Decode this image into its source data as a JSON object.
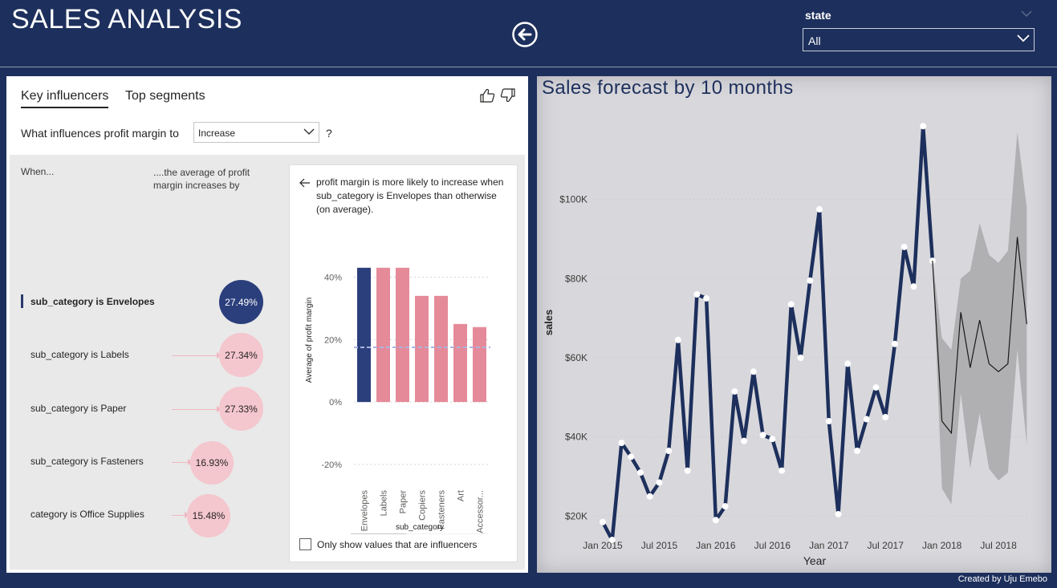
{
  "header": {
    "title": "SALES ANALYSIS",
    "back_icon": "back-arrow-circle-icon",
    "state_filter": {
      "label": "state",
      "value": "All"
    }
  },
  "key_influencers": {
    "tabs": [
      "Key influencers",
      "Top segments"
    ],
    "question_prefix": "What influences profit margin to",
    "question_value": "Increase",
    "question_suffix": "?",
    "when_header": "When...",
    "avg_header": "....the average of profit margin increases by",
    "influencers": [
      {
        "label": "sub_category is Envelopes",
        "value": "27.49%",
        "selected": true
      },
      {
        "label": "sub_category is Labels",
        "value": "27.34%",
        "selected": false
      },
      {
        "label": "sub_category is Paper",
        "value": "27.33%",
        "selected": false
      },
      {
        "label": "sub_category is Fasteners",
        "value": "16.93%",
        "selected": false
      },
      {
        "label": "category is Office Supplies",
        "value": "15.48%",
        "selected": false
      }
    ],
    "detail": {
      "text": "profit margin is more likely to increase when sub_category is Envelopes than otherwise (on average).",
      "checkbox_label": "Only show values that are influencers"
    },
    "colors": {
      "selected": "#2b3f7c",
      "other": "#f4c6cd",
      "bar_selected": "#2b3f7c",
      "bar_other": "#e58a99"
    }
  },
  "chart_data": [
    {
      "type": "bar",
      "categories": [
        "Envelopes",
        "Labels",
        "Paper",
        "Copiers",
        "Fasteners",
        "Art",
        "Accessor..."
      ],
      "values": [
        43,
        43,
        43,
        34,
        34,
        25,
        24
      ],
      "ylabel": "Average of profit margin",
      "xlabel": "sub_category",
      "yticks": [
        "40%",
        "20%",
        "0%",
        "-20%"
      ],
      "ylim": [
        -20,
        45
      ],
      "reference_line": 17.5
    },
    {
      "type": "line",
      "title": "Sales forecast by 10 months",
      "xlabel": "Year",
      "ylabel": "sales",
      "xticks": [
        "Jan 2015",
        "Jul 2015",
        "Jan 2016",
        "Jul 2016",
        "Jan 2017",
        "Jul 2017",
        "Jan 2018",
        "Jul 2018"
      ],
      "yticks": [
        "$100K",
        "$80K",
        "$60K",
        "$40K",
        "$20K"
      ],
      "ylim": [
        13000,
        122000
      ],
      "series": [
        {
          "values": [
            18500,
            14000,
            38500,
            35000,
            31000,
            25000,
            28500,
            36500,
            64500,
            31500,
            76000,
            75000,
            19000,
            22500,
            51500,
            39000,
            56500,
            40500,
            39500,
            31500,
            73500,
            60000,
            79500,
            97500,
            44000,
            20500,
            58500,
            36500,
            44500,
            52500,
            45000,
            63500,
            88000,
            78000,
            118500,
            84500
          ]
        },
        {
          "values": [
            84500,
            44000,
            41000,
            71500,
            57500,
            69500,
            58500,
            56500,
            58500,
            90500,
            68500
          ],
          "band_upper": [
            84500,
            65000,
            62000,
            80000,
            82000,
            94000,
            86000,
            84000,
            87000,
            117000,
            98000
          ],
          "band_lower": [
            84500,
            27000,
            23000,
            51000,
            32000,
            46000,
            32000,
            29000,
            31000,
            62000,
            38000
          ]
        }
      ]
    }
  ],
  "footer": {
    "credit": "Created by Uju Emebo"
  }
}
